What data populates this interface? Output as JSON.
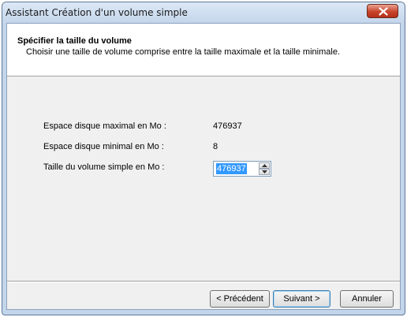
{
  "window": {
    "title": "Assistant Création d'un volume simple"
  },
  "header": {
    "title": "Spécifier la taille du volume",
    "subtitle": "Choisir une taille de volume comprise entre la taille maximale et la taille minimale."
  },
  "fields": {
    "max_label": "Espace disque maximal en Mo :",
    "max_value": "476937",
    "min_label": "Espace disque minimal en Mo :",
    "min_value": "8",
    "size_label": "Taille du volume simple en Mo :",
    "size_value": "476937"
  },
  "buttons": {
    "back": "< Précédent",
    "next": "Suivant >",
    "cancel": "Annuler"
  },
  "icons": {
    "close": "close-icon",
    "spin_up": "up-arrow-icon",
    "spin_down": "down-arrow-icon"
  }
}
